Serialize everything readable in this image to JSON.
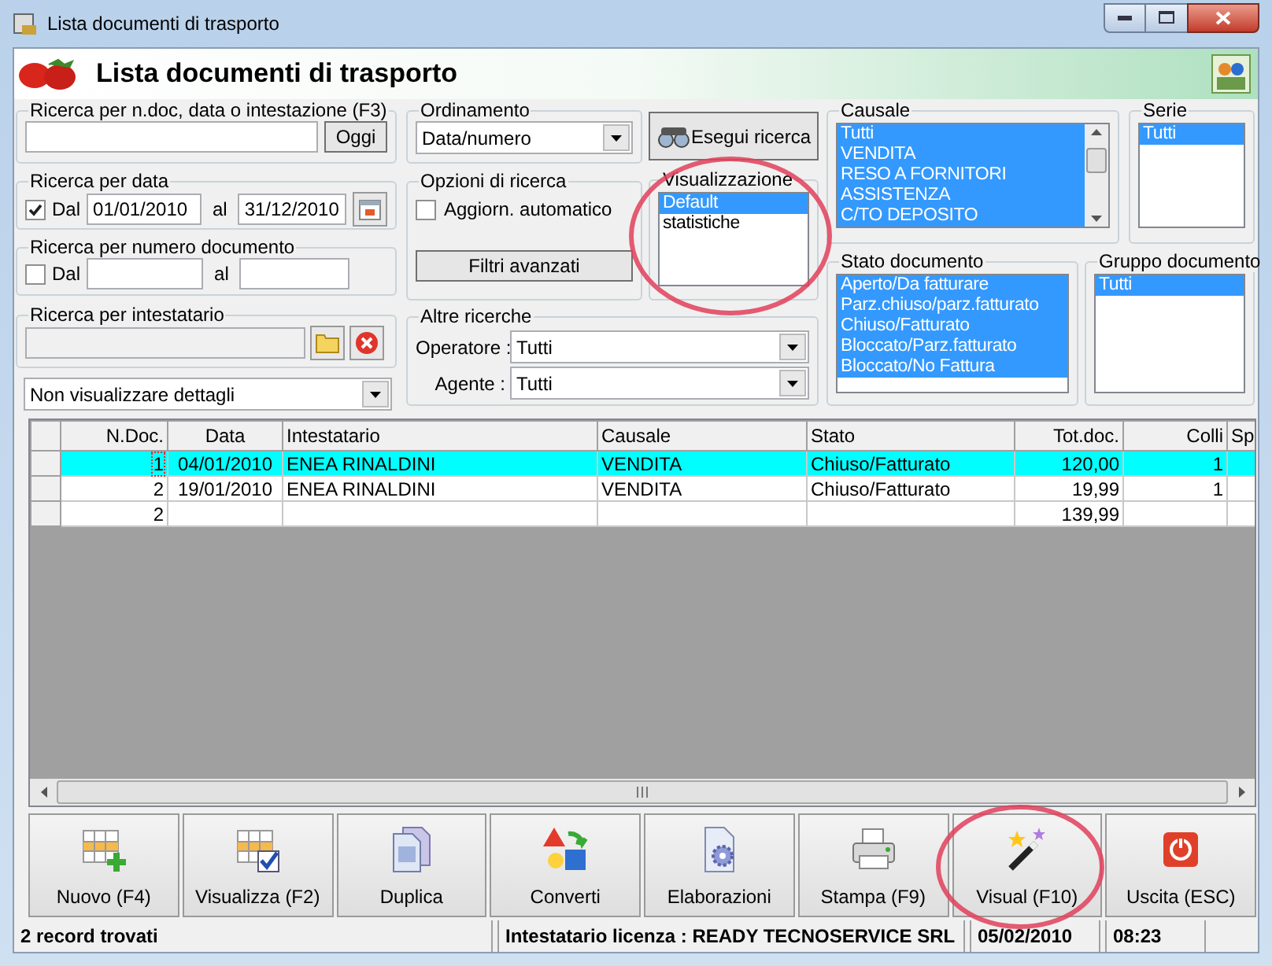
{
  "window": {
    "title": "Lista documenti di trasporto"
  },
  "header": {
    "title": "Lista documenti di trasporto"
  },
  "text_search": {
    "label": "Ricerca per n.doc, data o intestazione (F3)",
    "button": "Oggi"
  },
  "date_search": {
    "label": "Ricerca per data",
    "checked": true,
    "from_label": "Dal",
    "from": "01/01/2010",
    "to_label": "al",
    "to": "31/12/2010"
  },
  "number_search": {
    "label": "Ricerca per numero documento",
    "checked": false,
    "from_label": "Dal",
    "to_label": "al"
  },
  "holder_search": {
    "label": "Ricerca per intestatario"
  },
  "details_select": {
    "value": "Non visualizzare dettagli"
  },
  "ordering": {
    "label": "Ordinamento",
    "value": "Data/numero"
  },
  "search_options": {
    "label": "Opzioni di ricerca",
    "auto_update": {
      "label": "Aggiorn. automatico",
      "checked": false
    },
    "button": "Filtri avanzati"
  },
  "run_search_button": "Esegui ricerca",
  "view": {
    "label": "Visualizzazione",
    "items": [
      {
        "label": "Default",
        "selected": true
      },
      {
        "label": "statistiche",
        "selected": false
      }
    ]
  },
  "other_searches": {
    "label": "Altre ricerche",
    "fields": [
      {
        "label": "Operatore :",
        "value": "Tutti"
      },
      {
        "label": "Agente :",
        "value": "Tutti"
      }
    ]
  },
  "causale": {
    "label": "Causale",
    "items": [
      {
        "label": "Tutti",
        "selected": true
      },
      {
        "label": "VENDITA",
        "selected": true
      },
      {
        "label": "RESO A FORNITORI",
        "selected": true
      },
      {
        "label": "ASSISTENZA",
        "selected": true
      },
      {
        "label": "C/TO DEPOSITO",
        "selected": true
      }
    ]
  },
  "serie": {
    "label": "Serie",
    "items": [
      {
        "label": "Tutti",
        "selected": true
      }
    ]
  },
  "document_state": {
    "label": "Stato documento",
    "items": [
      {
        "label": "Aperto/Da fatturare",
        "selected": true
      },
      {
        "label": "Parz.chiuso/parz.fatturato",
        "selected": true
      },
      {
        "label": "Chiuso/Fatturato",
        "selected": true
      },
      {
        "label": "Bloccato/Parz.fatturato",
        "selected": true
      },
      {
        "label": "Bloccato/No Fattura",
        "selected": true
      }
    ]
  },
  "document_group": {
    "label": "Gruppo documento",
    "items": [
      {
        "label": "Tutti",
        "selected": true
      }
    ]
  },
  "table": {
    "columns": [
      "N.Doc.",
      "Data",
      "Intestatario",
      "Causale",
      "Stato",
      "Tot.doc.",
      "Colli",
      "Sp"
    ],
    "rows": [
      {
        "selected": true,
        "cells": [
          "1",
          "04/01/2010",
          "ENEA RINALDINI",
          "VENDITA",
          "Chiuso/Fatturato",
          "120,00",
          "1",
          null
        ]
      },
      {
        "selected": false,
        "cells": [
          "2",
          "19/01/2010",
          "ENEA RINALDINI",
          "VENDITA",
          "Chiuso/Fatturato",
          "19,99",
          "1",
          null
        ]
      },
      {
        "selected": false,
        "cells": [
          "2",
          null,
          null,
          null,
          null,
          "139,99",
          null,
          null
        ]
      }
    ]
  },
  "toolbar": [
    {
      "label": "Nuovo (F4)",
      "kind": "new"
    },
    {
      "label": "Visualizza (F2)",
      "kind": "view"
    },
    {
      "label": "Duplica",
      "kind": "duplicate"
    },
    {
      "label": "Converti",
      "kind": "convert"
    },
    {
      "label": "Elaborazioni",
      "kind": "process"
    },
    {
      "label": "Stampa (F9)",
      "kind": "print"
    },
    {
      "label": "Visual (F10)",
      "kind": "visual"
    },
    {
      "label": "Uscita (ESC)",
      "kind": "exit"
    }
  ],
  "status_bar": {
    "records": "2 record trovati",
    "license": "Intestatario licenza : READY TECNOSERVICE SRL",
    "date": "05/02/2010",
    "time": "08:23"
  }
}
